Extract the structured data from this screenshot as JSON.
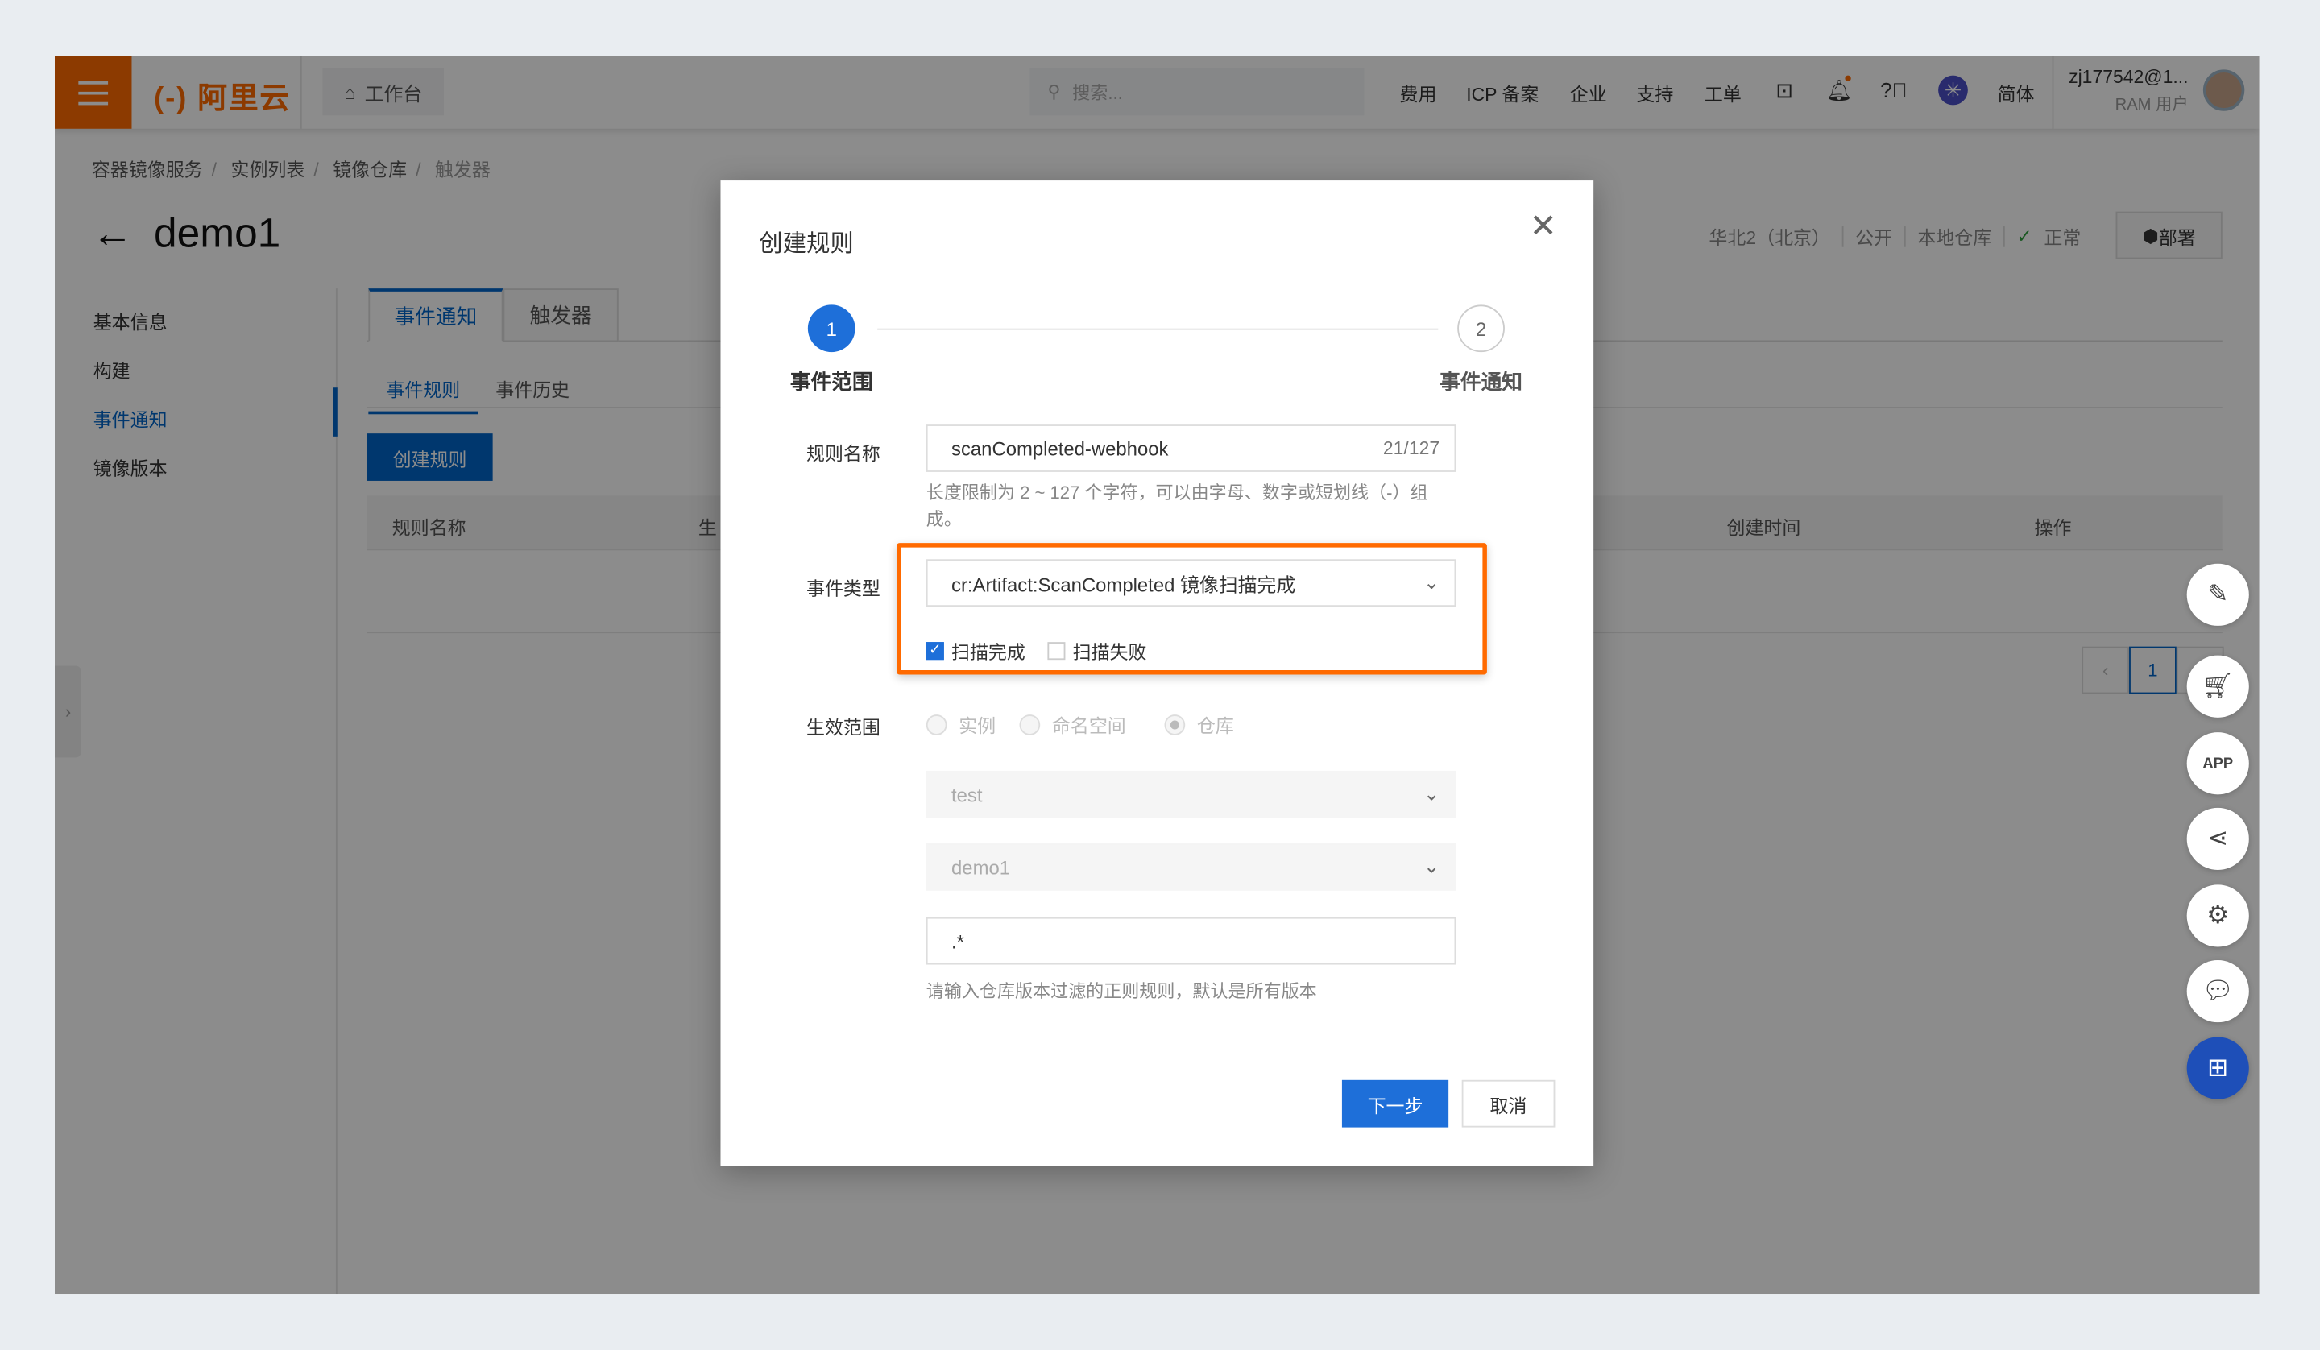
{
  "topbar": {
    "logo": "(-) 阿里云",
    "workbench": "工作台",
    "search_placeholder": "搜索...",
    "nav": [
      "费用",
      "ICP 备案",
      "企业",
      "支持",
      "工单"
    ],
    "lang": "简体",
    "user_name": "zj177542@1...",
    "user_role": "RAM 用户",
    "icons": [
      "terminal-icon",
      "bell-icon",
      "help-icon",
      "app-icon"
    ],
    "accent": "#ff6a00"
  },
  "breadcrumb": [
    "容器镜像服务",
    "实例列表",
    "镜像仓库",
    "触发器"
  ],
  "page": {
    "title": "demo1",
    "meta": [
      "华北2（北京）",
      "公开",
      "本地仓库",
      "正常"
    ],
    "deploy": "部署"
  },
  "sidebar": {
    "items": [
      "基本信息",
      "构建",
      "事件通知",
      "镜像版本"
    ],
    "active": "事件通知"
  },
  "tabs": [
    "事件通知",
    "触发器"
  ],
  "subtabs": [
    "事件规则",
    "事件历史"
  ],
  "create_button": "创建规则",
  "table": {
    "columns": [
      "规则名称",
      "生",
      "创建时间",
      "操作"
    ]
  },
  "pager": {
    "current": "1"
  },
  "modal": {
    "title": "创建规则",
    "steps": [
      {
        "num": "1",
        "label": "事件范围"
      },
      {
        "num": "2",
        "label": "事件通知"
      }
    ],
    "rule_name": {
      "label": "规则名称",
      "value": "scanCompleted-webhook",
      "count": "21/127",
      "help": "长度限制为 2 ~ 127 个字符，可以由字母、数字或短划线（-）组成。"
    },
    "event_type": {
      "label": "事件类型",
      "value": "cr:Artifact:ScanCompleted 镜像扫描完成",
      "options": [
        {
          "label": "扫描完成",
          "checked": true
        },
        {
          "label": "扫描失败",
          "checked": false
        }
      ]
    },
    "scope": {
      "label": "生效范围",
      "radios": [
        {
          "label": "实例",
          "selected": false
        },
        {
          "label": "命名空间",
          "selected": false
        },
        {
          "label": "仓库",
          "selected": true
        }
      ],
      "namespace": "test",
      "repo": "demo1",
      "filter": ".*",
      "help": "请输入仓库版本过滤的正则规则，默认是所有版本"
    },
    "next": "下一步",
    "cancel": "取消"
  },
  "colors": {
    "primary": "#1e6fd9",
    "highlight": "#ff6a00"
  }
}
